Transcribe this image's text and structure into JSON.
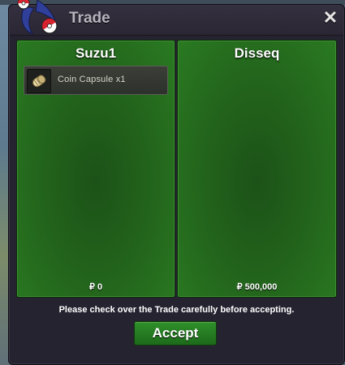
{
  "window": {
    "title": "Trade",
    "close_glyph": "✕"
  },
  "icons": {
    "logo": "pokeball-logo-icon",
    "close": "close-icon",
    "item": "coin-capsule-icon"
  },
  "left_player": {
    "name": "Suzu1",
    "items": [
      {
        "label": "Coin Capsule x1",
        "icon": "coin-capsule-icon"
      }
    ],
    "money": "₽ 0"
  },
  "right_player": {
    "name": "Disseq",
    "items": [],
    "money": "₽ 500,000"
  },
  "notice": "Please check over the Trade carefully before accepting.",
  "accept_label": "Accept",
  "colors": {
    "panel_green": "#22621b",
    "window_bg": "#262330",
    "accept_green": "#2f8f2a"
  }
}
